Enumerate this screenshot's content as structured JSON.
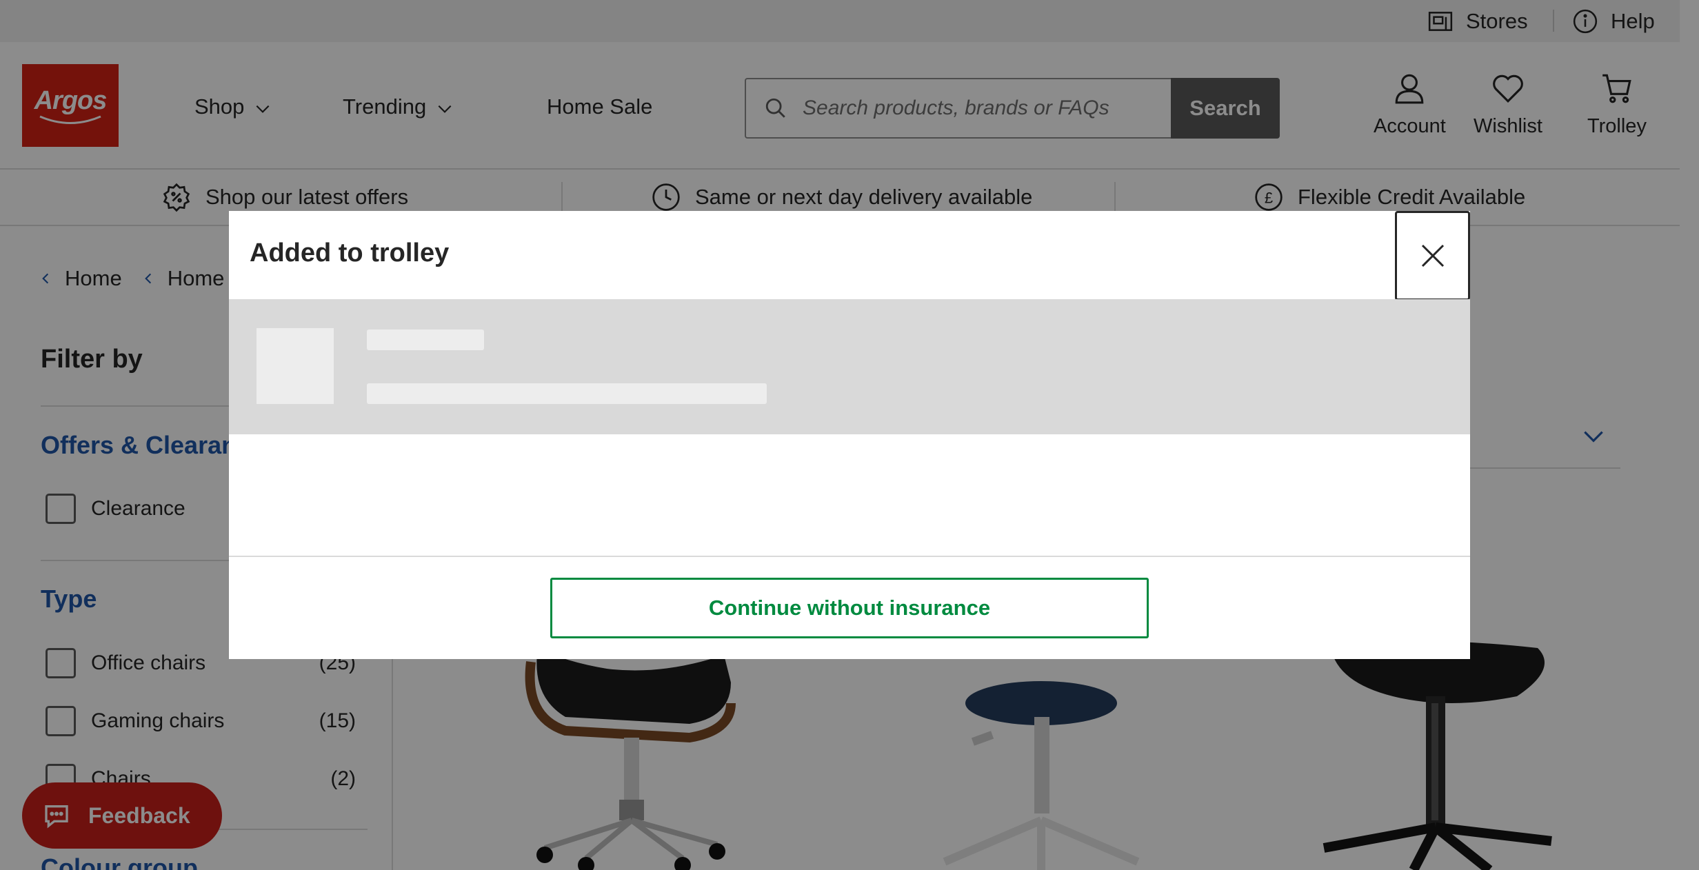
{
  "utility": {
    "stores_label": "Stores",
    "help_label": "Help"
  },
  "header": {
    "logo_text": "Argos",
    "nav": {
      "shop": "Shop",
      "trending": "Trending",
      "home_sale": "Home Sale"
    },
    "search": {
      "placeholder": "Search products, brands or FAQs",
      "button_label": "Search"
    },
    "actions": {
      "account": "Account",
      "wishlist": "Wishlist",
      "trolley": "Trolley"
    }
  },
  "promo": {
    "offers": "Shop our latest offers",
    "delivery": "Same or next day delivery available",
    "credit": "Flexible Credit Available"
  },
  "breadcrumb": {
    "items": [
      "Home",
      "Home a"
    ]
  },
  "filters": {
    "title": "Filter by",
    "offers_group": {
      "title": "Offers & Clearan",
      "options": [
        {
          "label": "Clearance",
          "count": ""
        }
      ]
    },
    "type_group": {
      "title": "Type",
      "options": [
        {
          "label": "Office chairs",
          "count": "(25)"
        },
        {
          "label": "Gaming chairs",
          "count": "(15)"
        },
        {
          "label": "Chairs",
          "count": "(2)"
        }
      ]
    },
    "colour_group": {
      "title": "Colour group"
    }
  },
  "feedback": {
    "label": "Feedback"
  },
  "modal": {
    "title": "Added to trolley",
    "continue_label": "Continue without insurance"
  },
  "colors": {
    "brand_red": "#d42114",
    "filter_blue": "#1f56a8",
    "continue_green": "#008a3f",
    "search_button": "#595959"
  }
}
